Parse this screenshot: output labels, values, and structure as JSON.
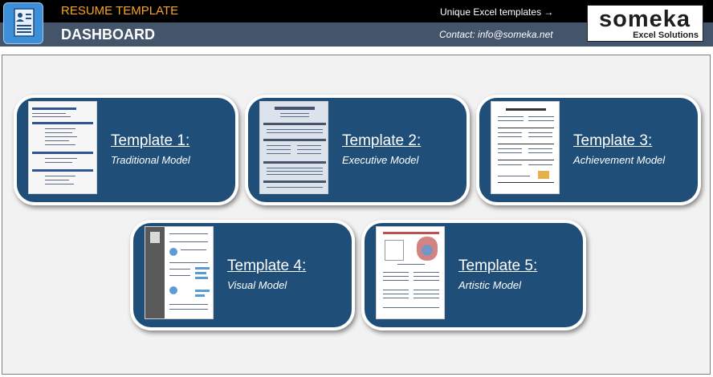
{
  "header": {
    "app_title": "RESUME TEMPLATE",
    "page_title": "DASHBOARD",
    "top_link": "Unique Excel templates →",
    "contact": "Contact: info@someka.net",
    "logo_main": "someka",
    "logo_sub": "Excel Solutions"
  },
  "colors": {
    "header_top": "#000000",
    "header_bottom": "#44546a",
    "app_title": "#f5a623",
    "card_fill": "#1f4e79"
  },
  "icons": {
    "app": "resume-document-icon"
  },
  "templates": [
    {
      "title": "Template 1:",
      "subtitle": "Traditional Model"
    },
    {
      "title": "Template 2:",
      "subtitle": "Executive Model"
    },
    {
      "title": "Template 3:",
      "subtitle": "Achievement Model"
    },
    {
      "title": "Template 4:",
      "subtitle": "Visual Model"
    },
    {
      "title": "Template 5:",
      "subtitle": "Artistic Model"
    }
  ]
}
